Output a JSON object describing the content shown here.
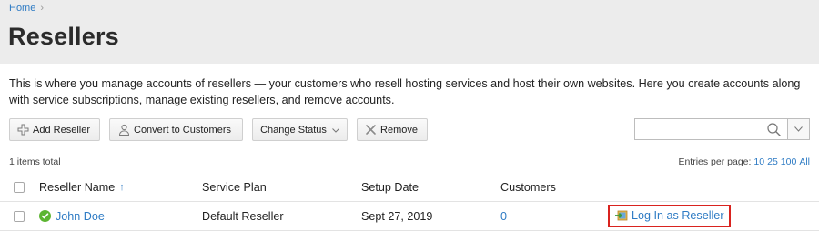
{
  "breadcrumb": {
    "home": "Home",
    "separator": "›"
  },
  "page": {
    "title": "Resellers",
    "description": "This is where you manage accounts of resellers — your customers who resell hosting services and host their own websites. Here you create accounts along with service subscriptions, manage existing resellers, and remove accounts."
  },
  "toolbar": {
    "add": "Add Reseller",
    "convert": "Convert to Customers",
    "change_status": "Change Status",
    "remove": "Remove"
  },
  "search": {
    "value": "",
    "placeholder": ""
  },
  "list": {
    "items_total": "1 items total",
    "entries_label": "Entries per page:",
    "page_sizes": [
      "10",
      "25",
      "100",
      "All"
    ]
  },
  "table": {
    "columns": {
      "name": "Reseller Name",
      "sort_arrow": "↑",
      "plan": "Service Plan",
      "setup_date": "Setup Date",
      "customers": "Customers"
    },
    "rows": [
      {
        "name": "John Doe",
        "status": "active",
        "plan": "Default Reseller",
        "setup_date": "Sept 27, 2019",
        "customers": "0",
        "action": "Log In as Reseller"
      }
    ]
  },
  "colors": {
    "link": "#2e7bc4",
    "header_bg": "#ececec",
    "status_ok": "#5cb531",
    "highlight": "#d9231f"
  },
  "icons": {
    "add": "plus-icon",
    "convert": "user-icon",
    "remove": "x-icon",
    "search": "search-icon",
    "status": "check-circle-icon",
    "login": "login-icon"
  }
}
